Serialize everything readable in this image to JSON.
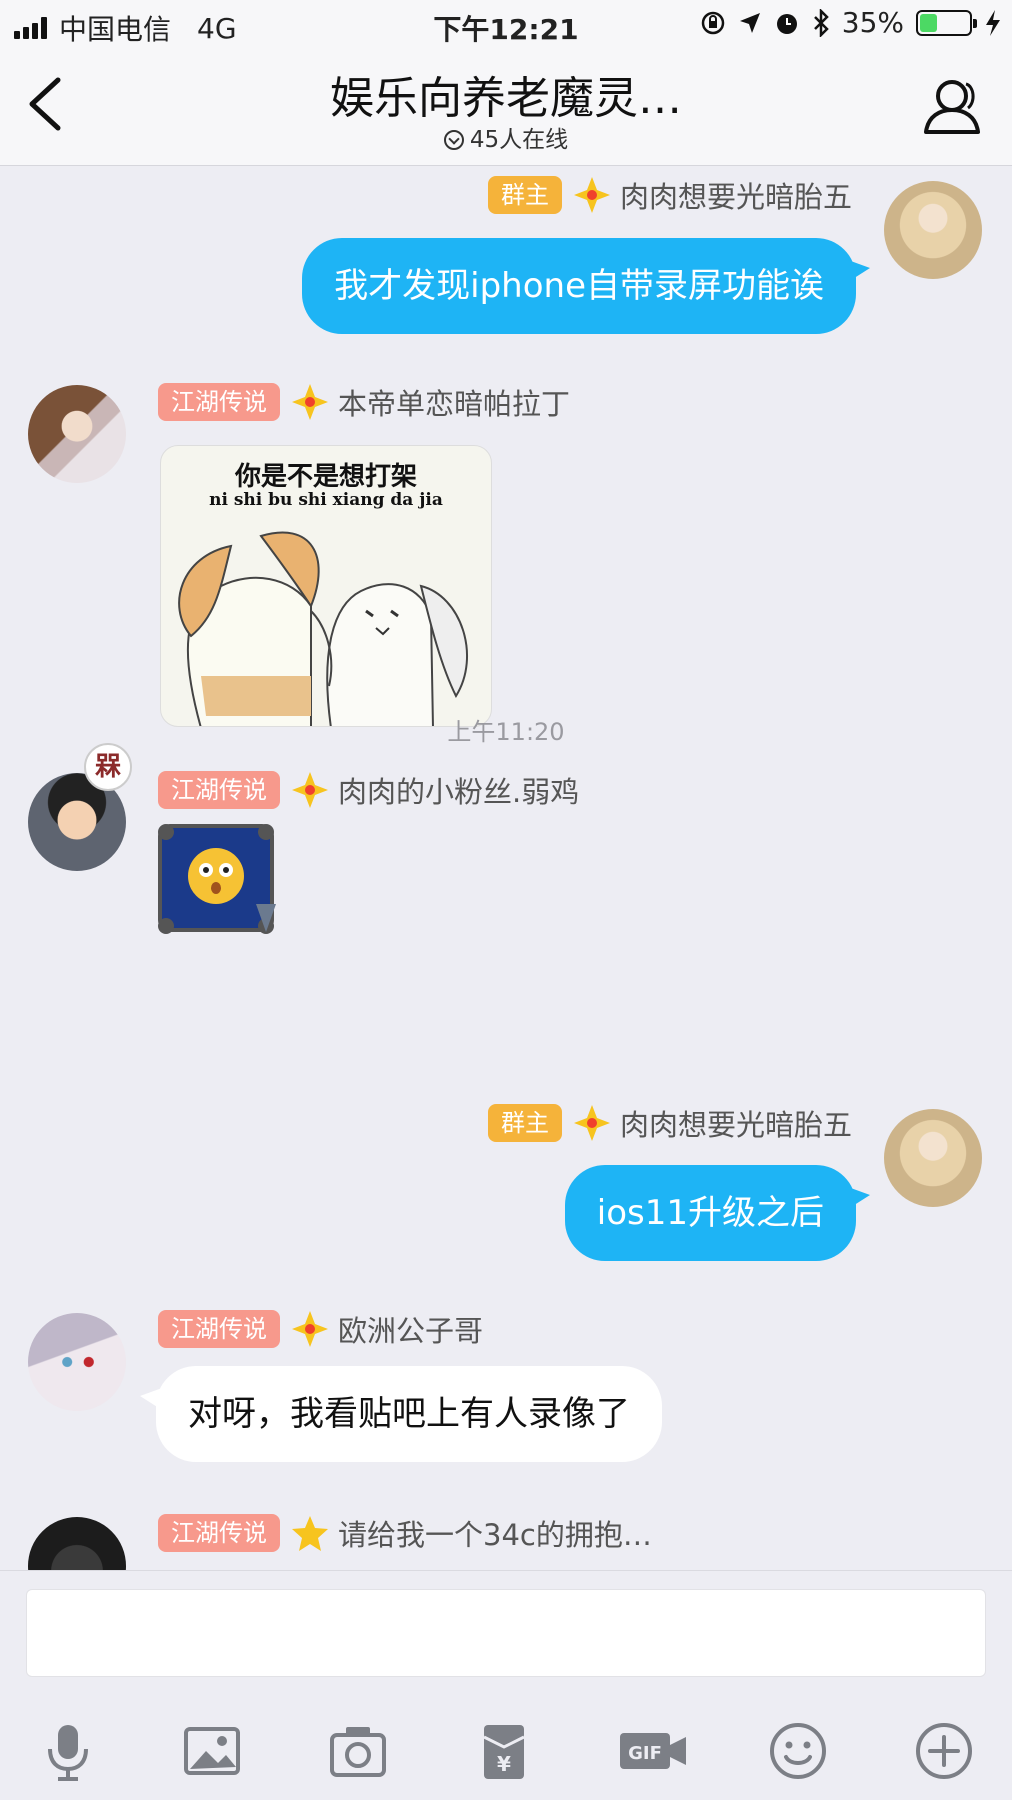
{
  "status_bar": {
    "carrier": "中国电信",
    "network": "4G",
    "time": "下午12:21",
    "battery_percent": "35%",
    "battery_level": 0.35,
    "icons": [
      "signal-icon",
      "screen-lock-icon",
      "location-icon",
      "alarm-icon",
      "bluetooth-icon",
      "battery-icon",
      "charging-icon"
    ]
  },
  "header": {
    "title": "娱乐向养老魔灵…",
    "online": "45人在线"
  },
  "messages": [
    {
      "side": "right",
      "tag": "群主",
      "nickname": "肉肉想要光暗胎五",
      "text": "我才发现iphone自带录屏功能诶"
    },
    {
      "side": "left",
      "tag": "江湖传说",
      "nickname": "本帝单恋暗帕拉丁",
      "image_caption": "你是不是想打架",
      "image_pinyin": "ni shi bu shi xiang da jia"
    },
    {
      "timestamp": "上午11:20"
    },
    {
      "side": "left",
      "tag": "江湖传说",
      "nickname": "肉肉的小粉丝.弱鸡",
      "corner_badge": "槑",
      "sticker": "surprised-emoji-sticker"
    },
    {
      "side": "right",
      "tag": "群主",
      "nickname": "肉肉想要光暗胎五",
      "text": "ios11升级之后"
    },
    {
      "side": "left",
      "tag": "江湖传说",
      "nickname": "欧洲公子哥",
      "text": "对呀，我看贴吧上有人录像了"
    },
    {
      "side": "left",
      "tag": "江湖传说",
      "nickname": "请给我一个34c的拥抱…"
    }
  ],
  "input": {
    "value": "",
    "placeholder": ""
  },
  "toolbar": [
    "microphone-icon",
    "image-icon",
    "camera-icon",
    "red-packet-icon",
    "gif-icon",
    "emoji-icon",
    "plus-icon"
  ],
  "colors": {
    "bubble_blue": "#1eb4f5",
    "owner_tag": "#f5b33a",
    "legend_tag": "#f7998c",
    "background": "#ededf3"
  }
}
